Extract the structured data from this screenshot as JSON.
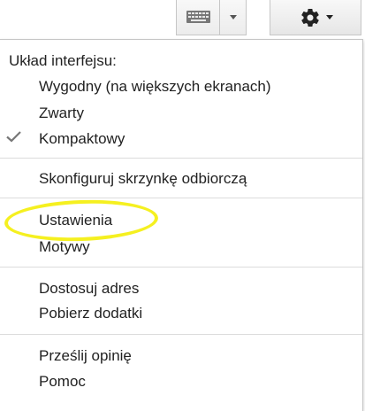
{
  "toolbar": {
    "keyboard_icon": "keyboard-icon",
    "keyboard_dropdown_icon": "chevron-down-icon",
    "settings_icon": "gear-icon",
    "settings_dropdown_icon": "chevron-down-icon"
  },
  "menu": {
    "density_header": "Układ interfejsu:",
    "density_options": [
      {
        "label": "Wygodny (na większych ekranach)",
        "checked": false
      },
      {
        "label": "Zwarty",
        "checked": false
      },
      {
        "label": "Kompaktowy",
        "checked": true
      }
    ],
    "configure_inbox": "Skonfiguruj skrzynkę odbiorczą",
    "settings": "Ustawienia",
    "themes": "Motywy",
    "custom_address": "Dostosuj adres",
    "get_addons": "Pobierz dodatki",
    "send_feedback": "Prześlij opinię",
    "help": "Pomoc"
  },
  "colors": {
    "highlight_ellipse": "#f5f020",
    "text": "#222222",
    "separator": "#dcdcdc",
    "checkmark": "#777777"
  }
}
